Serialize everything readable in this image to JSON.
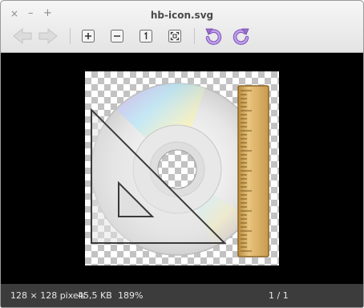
{
  "window": {
    "title": "hb-icon.svg",
    "controls": {
      "close": "×",
      "minimize": "–",
      "maximize": "+"
    }
  },
  "toolbar": {
    "buttons": [
      "back",
      "forward",
      "zoom-in",
      "zoom-out",
      "zoom-original",
      "zoom-fit",
      "rotate-left",
      "rotate-right"
    ]
  },
  "image": {
    "name": "hb-icon.svg"
  },
  "status": {
    "dimensions": "128 × 128 pixels",
    "filesize": "45,5 KB",
    "zoom": "189%",
    "page": "1 / 1"
  },
  "colors": {
    "accent_rotate": "#9b6fd0",
    "statusbar_bg": "#3c3c3c",
    "ruler": "#d7ad62"
  }
}
